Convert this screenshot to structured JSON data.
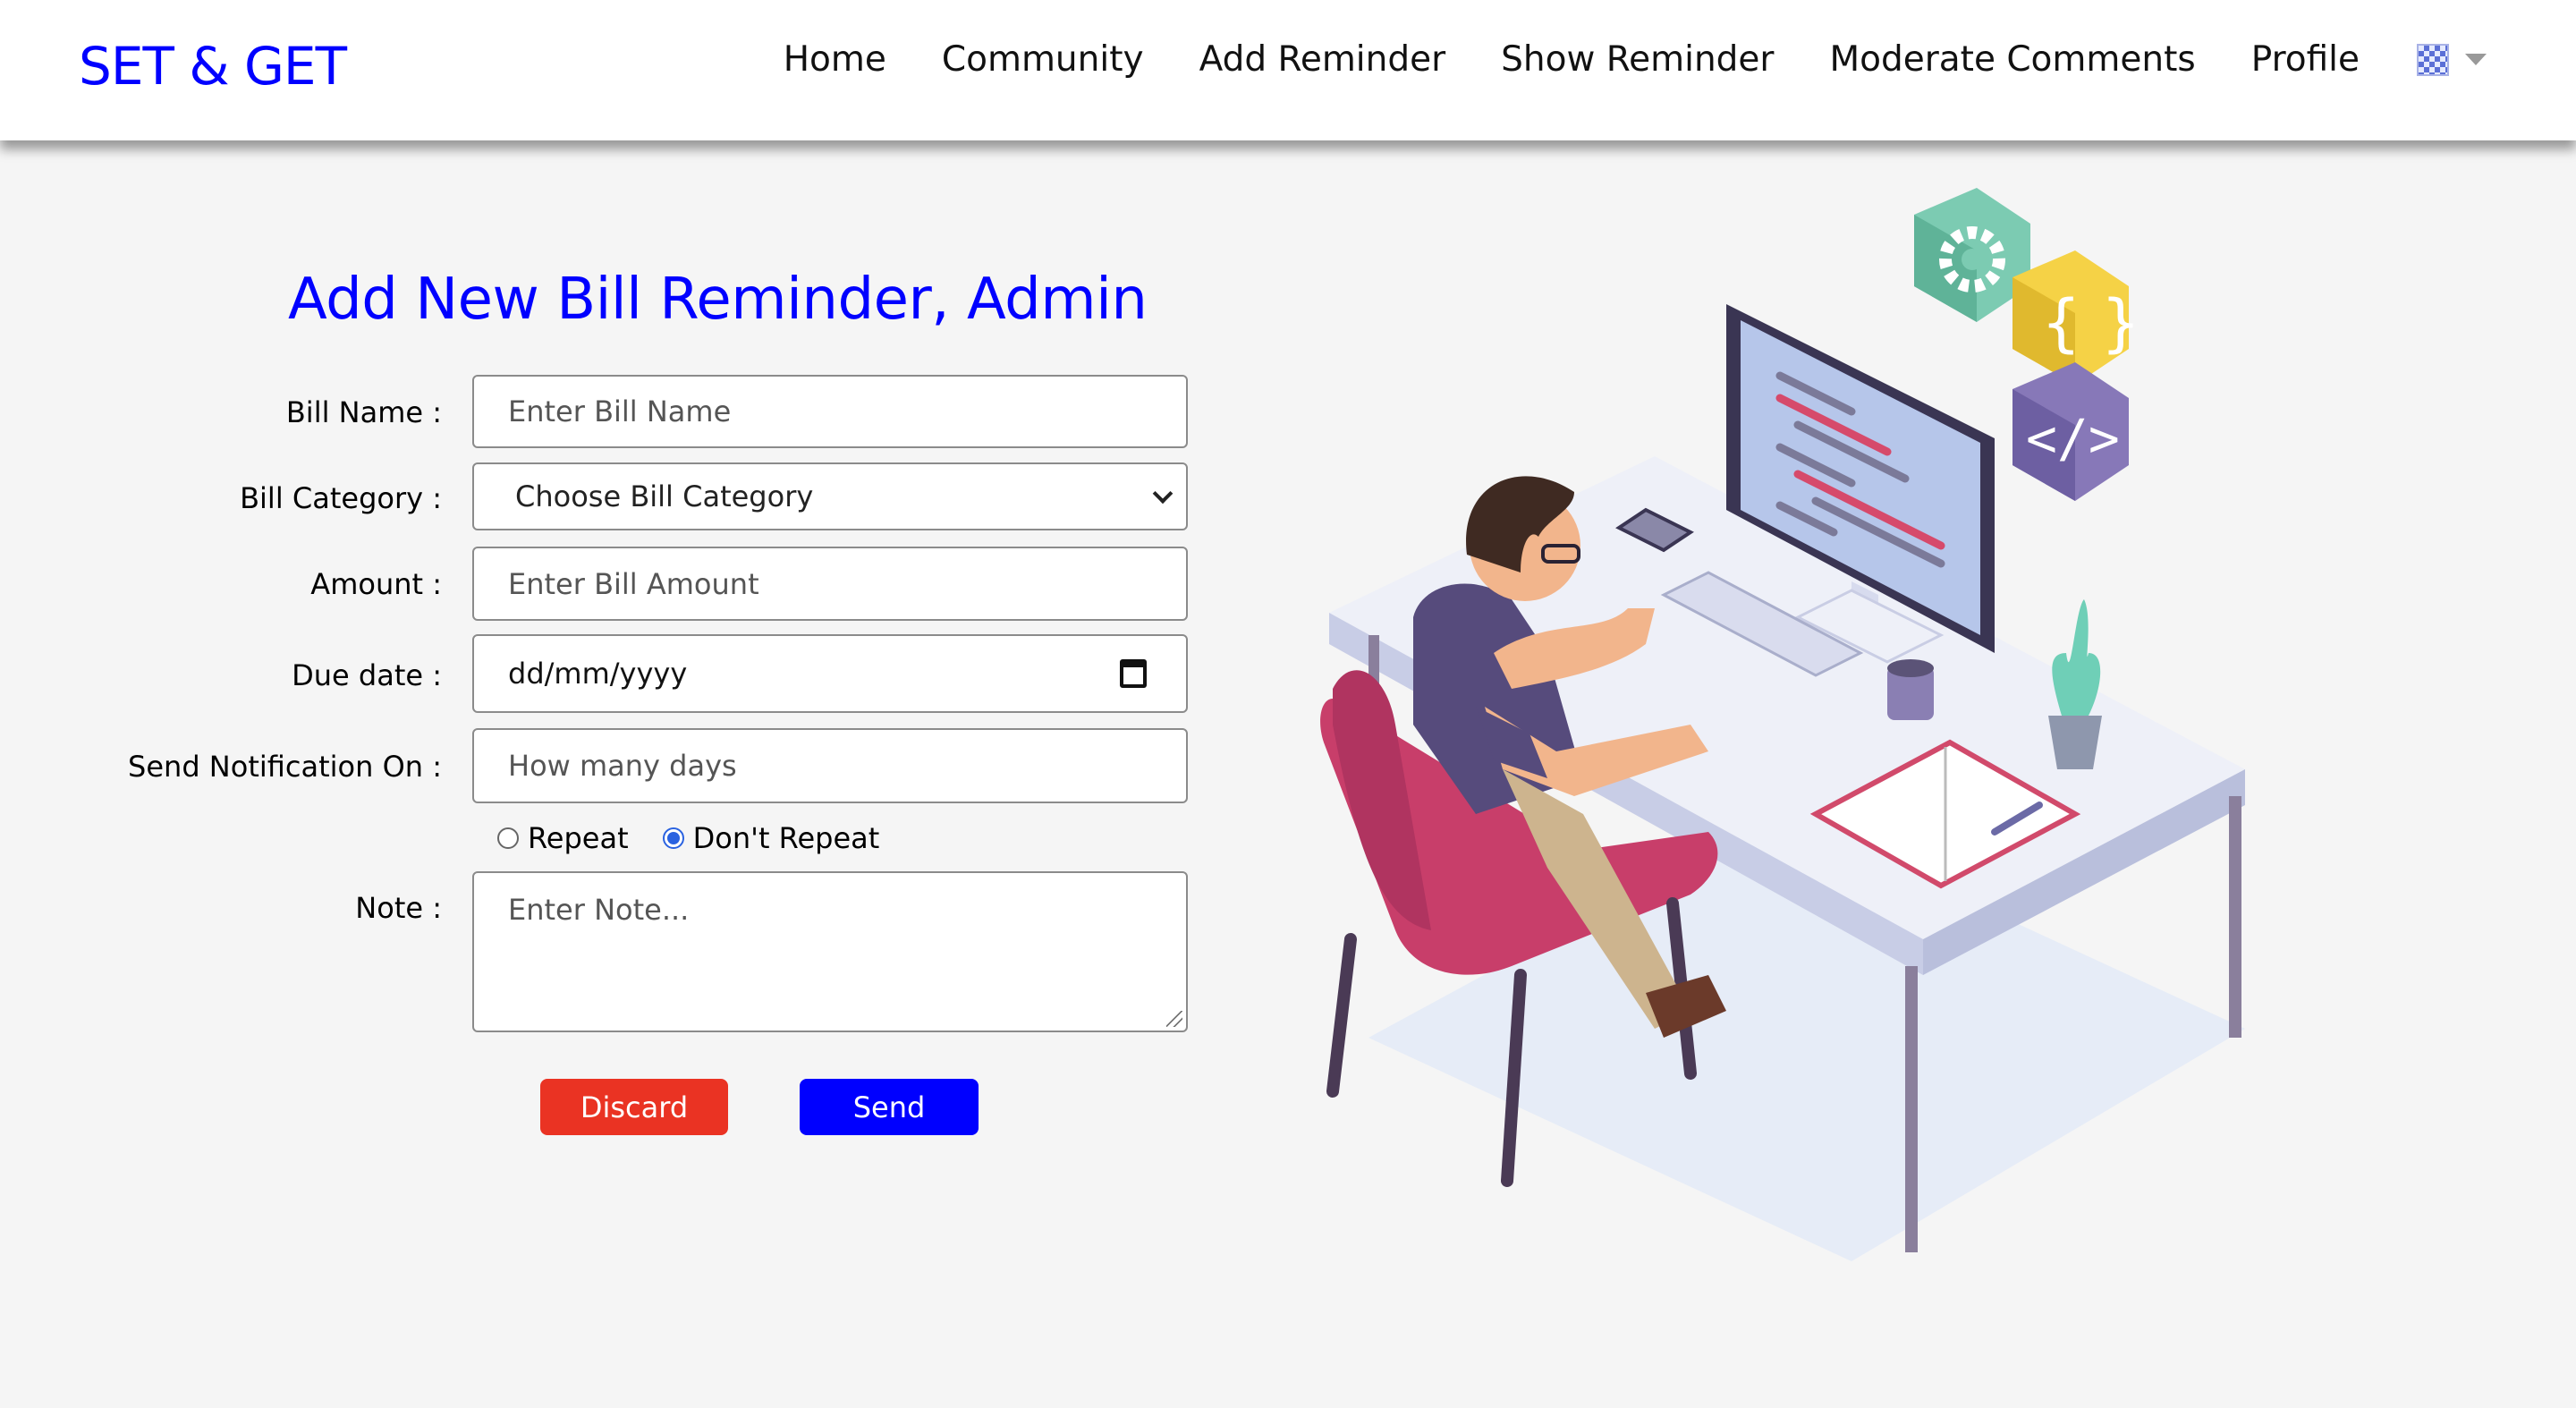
{
  "nav": {
    "brand": "SET & GET",
    "links": [
      "Home",
      "Community",
      "Add Reminder",
      "Show Reminder",
      "Moderate Comments",
      "Profile"
    ],
    "language_icon": "flag-icon"
  },
  "form": {
    "title": "Add New Bill Reminder, Admin",
    "bill_name": {
      "label": "Bill Name :",
      "placeholder": "Enter Bill Name"
    },
    "bill_category": {
      "label": "Bill Category :",
      "selected": "Choose Bill Category"
    },
    "amount": {
      "label": "Amount :",
      "placeholder": "Enter Bill Amount"
    },
    "due_date": {
      "label": "Due date :",
      "value": "dd/mm/yyyy"
    },
    "notify": {
      "label": "Send Notification On :",
      "placeholder": "How many days"
    },
    "repeat_options": {
      "repeat": "Repeat",
      "dont_repeat": "Don't Repeat",
      "selected": "dont_repeat"
    },
    "note": {
      "label": "Note :",
      "placeholder": "Enter Note..."
    },
    "buttons": {
      "discard": "Discard",
      "send": "Send"
    }
  },
  "colors": {
    "brand": "#0000ff",
    "discard": "#ea3323",
    "send": "#0000ff",
    "background": "#f5f5f5"
  }
}
